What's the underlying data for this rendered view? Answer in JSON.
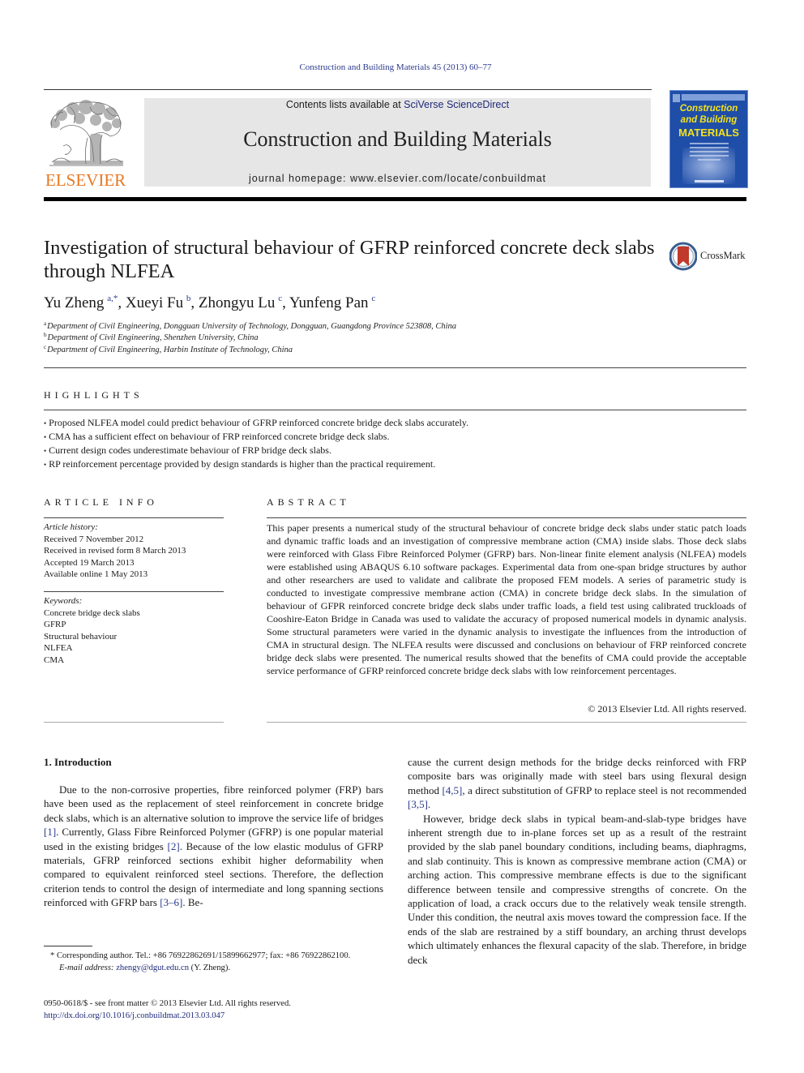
{
  "running_head": "Construction and Building Materials 45 (2013) 60–77",
  "masthead": {
    "contents_prefix": "Contents lists available at ",
    "contents_link": "SciVerse ScienceDirect",
    "journal_title": "Construction and Building Materials",
    "homepage": "journal homepage: www.elsevier.com/locate/conbuildmat",
    "publisher_logo_text": "ELSEVIER",
    "cover": {
      "line1": "Construction",
      "line2": "and Building",
      "line3": "MATERIALS"
    }
  },
  "crossmark_label": "CrossMark",
  "article": {
    "title": "Investigation of structural behaviour of GFRP reinforced concrete deck slabs through NLFEA",
    "authors": [
      {
        "name": "Yu Zheng",
        "sup": "a,*",
        "sep": ", "
      },
      {
        "name": "Xueyi Fu",
        "sup": "b",
        "sep": ", "
      },
      {
        "name": "Zhongyu Lu",
        "sup": "c",
        "sep": ", "
      },
      {
        "name": "Yunfeng Pan",
        "sup": "c",
        "sep": ""
      }
    ],
    "affiliations": [
      {
        "key": "a",
        "text": "Department of Civil Engineering, Dongguan University of Technology, Dongguan, Guangdong Province 523808, China"
      },
      {
        "key": "b",
        "text": "Department of Civil Engineering, Shenzhen University, China"
      },
      {
        "key": "c",
        "text": "Department of Civil Engineering, Harbin Institute of Technology, China"
      }
    ]
  },
  "highlights": {
    "heading": "HIGHLIGHTS",
    "items": [
      "Proposed NLFEA model could predict behaviour of GFRP reinforced concrete bridge deck slabs accurately.",
      "CMA has a sufficient effect on behaviour of FRP reinforced concrete bridge deck slabs.",
      "Current design codes underestimate behaviour of FRP bridge deck slabs.",
      "RP reinforcement percentage provided by design standards is higher than the practical requirement."
    ]
  },
  "article_info": {
    "heading": "ARTICLE INFO",
    "history_label": "Article history:",
    "history": [
      "Received 7 November 2012",
      "Received in revised form 8 March 2013",
      "Accepted 19 March 2013",
      "Available online 1 May 2013"
    ],
    "keywords_label": "Keywords:",
    "keywords": [
      "Concrete bridge deck slabs",
      "GFRP",
      "Structural behaviour",
      "NLFEA",
      "CMA"
    ]
  },
  "abstract": {
    "heading": "ABSTRACT",
    "text": "This paper presents a numerical study of the structural behaviour of concrete bridge deck slabs under static patch loads and dynamic traffic loads and an investigation of compressive membrane action (CMA) inside slabs. Those deck slabs were reinforced with Glass Fibre Reinforced Polymer (GFRP) bars. Non-linear finite element analysis (NLFEA) models were established using ABAQUS 6.10 software packages. Experimental data from one-span bridge structures by author and other researchers are used to validate and calibrate the proposed FEM models. A series of parametric study is conducted to investigate compressive membrane action (CMA) in concrete bridge deck slabs. In the simulation of behaviour of GFPR reinforced concrete bridge deck slabs under traffic loads, a field test using calibrated truckloads of Cooshire-Eaton Bridge in Canada was used to validate the accuracy of proposed numerical models in dynamic analysis. Some structural parameters were varied in the dynamic analysis to investigate the influences from the introduction of CMA in structural design. The NLFEA results were discussed and conclusions on behaviour of FRP reinforced concrete bridge deck slabs were presented. The numerical results showed that the benefits of CMA could provide the acceptable service performance of GFRP reinforced concrete bridge deck slabs with low reinforcement percentages.",
    "copyright": "© 2013 Elsevier Ltd. All rights reserved."
  },
  "introduction": {
    "heading": "1. Introduction",
    "left_p1": {
      "t1": "Due to the non-corrosive properties, fibre reinforced polymer (FRP) bars have been used as the replacement of steel reinforcement in concrete bridge deck slabs, which is an alternative solution to improve the service life of bridges ",
      "c1": "[1]",
      "t2": ". Currently, Glass Fibre Reinforced Polymer (GFRP) is one popular material used in the existing bridges ",
      "c2": "[2]",
      "t3": ". Because of the low elastic modulus of GFRP materials, GFRP reinforced sections exhibit higher deformability when compared to equivalent reinforced steel sections. Therefore, the deflection criterion tends to control the design of intermediate and long spanning sections reinforced with GFRP bars ",
      "c3": "[3–6]",
      "t4": ". Be-"
    },
    "right_p1": {
      "t1": "cause the current design methods for the bridge decks reinforced with FRP composite bars was originally made with steel bars using flexural design method ",
      "c1": "[4,5]",
      "t2": ", a direct substitution of GFRP to replace steel is not recommended ",
      "c2": "[3,5]",
      "t3": "."
    },
    "right_p2": "However, bridge deck slabs in typical beam-and-slab-type bridges have inherent strength due to in-plane forces set up as a result of the restraint provided by the slab panel boundary conditions, including beams, diaphragms, and slab continuity. This is known as compressive membrane action (CMA) or arching action. This compressive membrane effects is due to the significant difference between tensile and compressive strengths of concrete. On the application of load, a crack occurs due to the relatively weak tensile strength. Under this condition, the neutral axis moves toward the compression face. If the ends of the slab are restrained by a stiff boundary, an arching thrust develops which ultimately enhances the flexural capacity of the slab. Therefore, in bridge deck"
  },
  "footnote": {
    "corresponding": "* Corresponding author. Tel.: +86 76922862691/15899662977; fax: +86 76922862100.",
    "email_label": "E-mail address:",
    "email": "zhengy@dgut.edu.cn",
    "email_suffix": " (Y. Zheng)."
  },
  "front_matter": {
    "issn_line": "0950-0618/$ - see front matter © 2013 Elsevier Ltd. All rights reserved.",
    "doi": "http://dx.doi.org/10.1016/j.conbuildmat.2013.03.047"
  },
  "colors": {
    "link": "#2b3a8c",
    "elsevier_orange": "#e87722",
    "cover_blue": "#1f4ea8",
    "cover_yellow": "#f5e21a",
    "masthead_grey": "#e6e6e6"
  }
}
